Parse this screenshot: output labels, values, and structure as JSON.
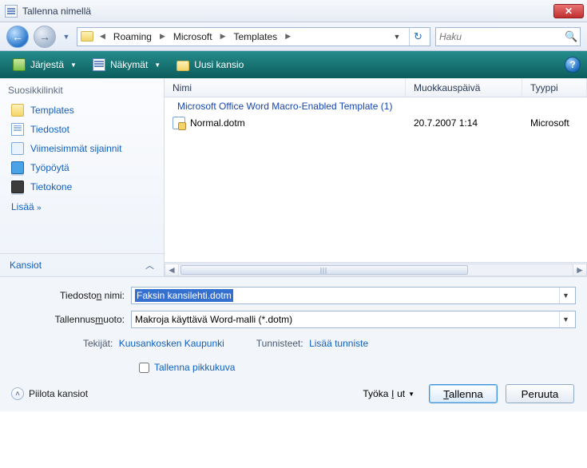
{
  "window": {
    "title": "Tallenna nimellä"
  },
  "breadcrumb": {
    "items": [
      "Roaming",
      "Microsoft",
      "Templates"
    ]
  },
  "search": {
    "placeholder": "Haku"
  },
  "toolbar": {
    "organize": "Järjestä",
    "views": "Näkymät",
    "new_folder": "Uusi kansio"
  },
  "sidebar": {
    "header": "Suosikkilinkit",
    "items": [
      {
        "label": "Templates",
        "icon": "folder"
      },
      {
        "label": "Tiedostot",
        "icon": "docs"
      },
      {
        "label": "Viimeisimmät sijainnit",
        "icon": "recent"
      },
      {
        "label": "Työpöytä",
        "icon": "desktop"
      },
      {
        "label": "Tietokone",
        "icon": "computer"
      }
    ],
    "more": "Lisää",
    "folders": "Kansiot"
  },
  "columns": {
    "name": "Nimi",
    "modified": "Muokkauspäivä",
    "type": "Tyyppi"
  },
  "group": "Microsoft Office Word Macro-Enabled Template (1)",
  "files": [
    {
      "name": "Normal.dotm",
      "modified": "20.7.2007 1:14",
      "type": "Microsoft"
    }
  ],
  "form": {
    "filename_label_pre": "Tiedosto",
    "filename_label_u": "n",
    "filename_label_post": " nimi:",
    "filename_value": "Faksin kansilehti.dotm",
    "format_label_pre": "Tallennus",
    "format_label_u": "m",
    "format_label_post": "uoto:",
    "format_value": "Makroja käyttävä Word-malli (*.dotm)",
    "authors_key": "Tekijät:",
    "authors_val": "Kuusankosken Kaupunki",
    "tags_key": "Tunnisteet:",
    "tags_val": "Lisää tunniste",
    "thumb": "Tallenna pikkukuva"
  },
  "footer": {
    "hide_folders": "Piilota kansiot",
    "tools_pre": "Työka",
    "tools_u": "l",
    "tools_post": "ut",
    "save_pre": "",
    "save_u": "T",
    "save_post": "allenna",
    "cancel": "Peruuta"
  }
}
